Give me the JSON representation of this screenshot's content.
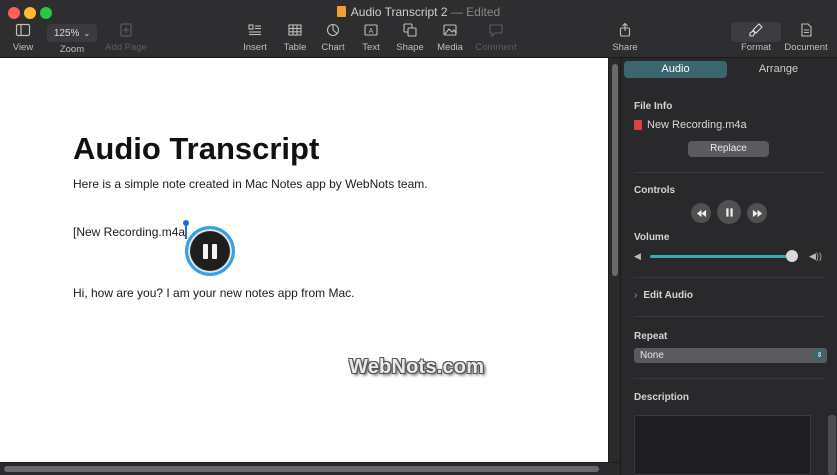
{
  "window": {
    "title": "Audio Transcript 2",
    "title_separator": " — ",
    "status": "Edited"
  },
  "toolbar": {
    "view": "View",
    "zoom_value": "125%",
    "zoom": "Zoom",
    "add_page": "Add Page",
    "insert": "Insert",
    "table": "Table",
    "chart": "Chart",
    "text": "Text",
    "shape": "Shape",
    "media": "Media",
    "comment": "Comment",
    "share": "Share",
    "format": "Format",
    "document": "Document"
  },
  "document": {
    "heading": "Audio Transcript",
    "line1": "Here is a simple note created in Mac Notes app by WebNots team.",
    "recording_label": "[New Recording.m4a",
    "line2": "Hi, how are you? I am your new notes app from Mac.",
    "watermark": "WebNots.com"
  },
  "inspector": {
    "tabs": [
      "Audio",
      "Arrange"
    ],
    "file_info_label": "File Info",
    "file_name": "New Recording.m4a",
    "replace_button": "Replace",
    "controls_label": "Controls",
    "volume_label": "Volume",
    "volume_level": 0.98,
    "edit_audio_label": "Edit Audio",
    "repeat_label": "Repeat",
    "repeat_value": "None",
    "description_label": "Description"
  },
  "colors": {
    "accent": "#3b6670",
    "play_ring": "#2fa4e7",
    "volume_track": "#3da6b5"
  }
}
